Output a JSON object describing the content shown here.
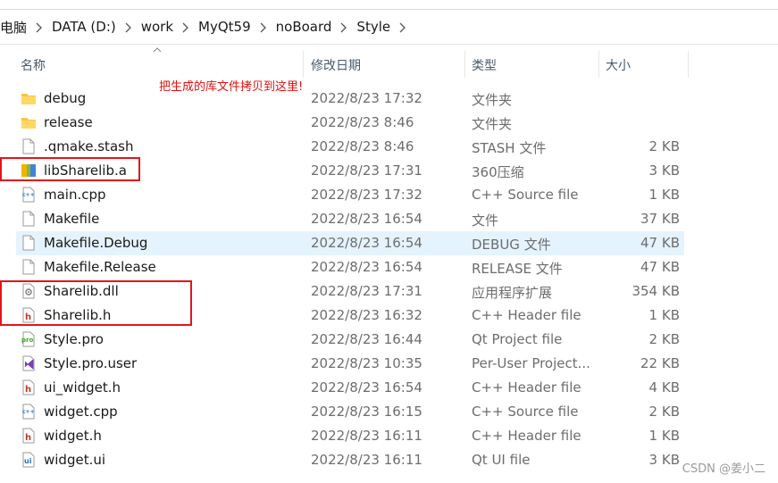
{
  "breadcrumb": [
    "电脑",
    "DATA (D:)",
    "work",
    "MyQt59",
    "noBoard",
    "Style"
  ],
  "columns": {
    "name": "名称",
    "date": "修改日期",
    "type": "类型",
    "size": "大小"
  },
  "annotation": "把生成的库文件拷贝到这里!",
  "files": [
    {
      "name": "debug",
      "date": "2022/8/23 17:32",
      "type": "文件夹",
      "size": "",
      "icon": "folder-icon"
    },
    {
      "name": "release",
      "date": "2022/8/23 8:46",
      "type": "文件夹",
      "size": "",
      "icon": "folder-icon"
    },
    {
      "name": ".qmake.stash",
      "date": "2022/8/23 8:46",
      "type": "STASH 文件",
      "size": "2 KB",
      "icon": "file-icon"
    },
    {
      "name": "libSharelib.a",
      "date": "2022/8/23 17:31",
      "type": "360压缩",
      "size": "3 KB",
      "icon": "archive-icon"
    },
    {
      "name": "main.cpp",
      "date": "2022/8/23 17:32",
      "type": "C++ Source file",
      "size": "1 KB",
      "icon": "cpp-icon"
    },
    {
      "name": "Makefile",
      "date": "2022/8/23 16:54",
      "type": "文件",
      "size": "37 KB",
      "icon": "file-icon"
    },
    {
      "name": "Makefile.Debug",
      "date": "2022/8/23 16:54",
      "type": "DEBUG 文件",
      "size": "47 KB",
      "icon": "file-icon"
    },
    {
      "name": "Makefile.Release",
      "date": "2022/8/23 16:54",
      "type": "RELEASE 文件",
      "size": "47 KB",
      "icon": "file-icon"
    },
    {
      "name": "Sharelib.dll",
      "date": "2022/8/23 17:31",
      "type": "应用程序扩展",
      "size": "354 KB",
      "icon": "dll-icon"
    },
    {
      "name": "Sharelib.h",
      "date": "2022/8/23 16:32",
      "type": "C++ Header file",
      "size": "1 KB",
      "icon": "header-icon"
    },
    {
      "name": "Style.pro",
      "date": "2022/8/23 16:44",
      "type": "Qt Project file",
      "size": "2 KB",
      "icon": "pro-icon"
    },
    {
      "name": "Style.pro.user",
      "date": "2022/8/23 10:35",
      "type": "Per-User Project...",
      "size": "22 KB",
      "icon": "vs-icon"
    },
    {
      "name": "ui_widget.h",
      "date": "2022/8/23 16:54",
      "type": "C++ Header file",
      "size": "4 KB",
      "icon": "header-icon"
    },
    {
      "name": "widget.cpp",
      "date": "2022/8/23 16:15",
      "type": "C++ Source file",
      "size": "2 KB",
      "icon": "cpp-icon"
    },
    {
      "name": "widget.h",
      "date": "2022/8/23 16:11",
      "type": "C++ Header file",
      "size": "1 KB",
      "icon": "header-icon"
    },
    {
      "name": "widget.ui",
      "date": "2022/8/23 16:11",
      "type": "Qt UI file",
      "size": "3 KB",
      "icon": "ui-icon"
    }
  ],
  "selected_index": 6,
  "watermark": "CSDN @姜小二",
  "colors": {
    "highlight": "#e5f3ff",
    "annotation": "#e01010",
    "box": "#e3151a"
  }
}
